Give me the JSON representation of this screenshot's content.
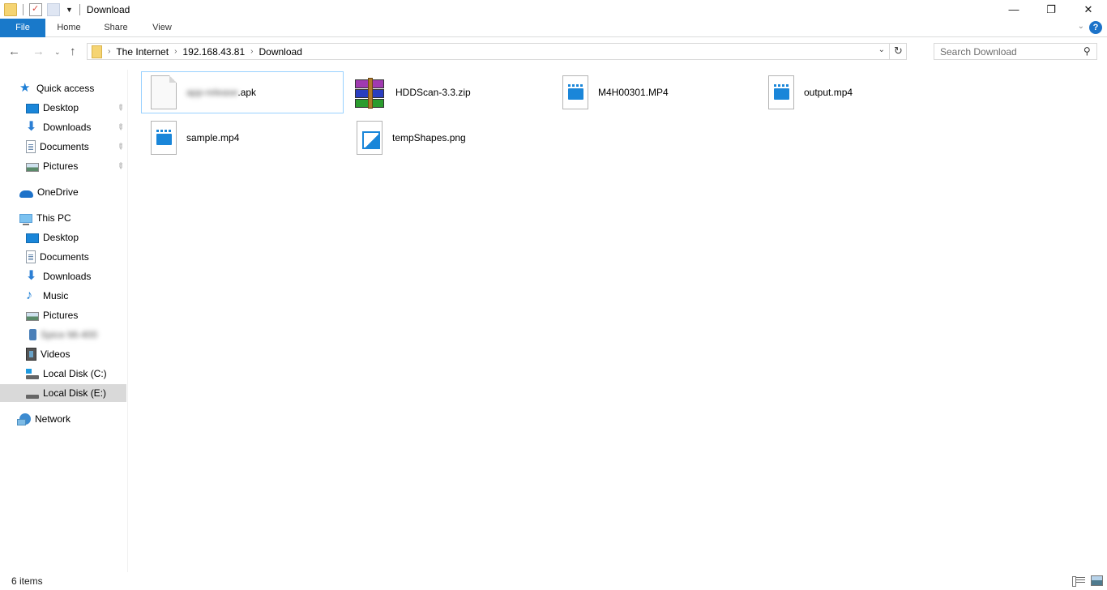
{
  "window": {
    "title": "Download",
    "controls": {
      "minimize": "—",
      "restore": "❐",
      "close": "✕"
    }
  },
  "ribbon": {
    "tabs": [
      {
        "label": "File",
        "active": true
      },
      {
        "label": "Home"
      },
      {
        "label": "Share"
      },
      {
        "label": "View"
      }
    ],
    "expand_glyph": "⌄",
    "help_glyph": "?"
  },
  "nav": {
    "back": "←",
    "forward": "→",
    "recent": "⌄",
    "up": "↑",
    "breadcrumb": [
      "The Internet",
      "192.168.43.81",
      "Download"
    ],
    "crumb_sep": "›",
    "dropdown": "⌄",
    "refresh": "↻"
  },
  "search": {
    "placeholder": "Search Download",
    "value": "",
    "icon": "⚲"
  },
  "sidebar": {
    "quick_access": {
      "label": "Quick access",
      "items": [
        {
          "label": "Desktop",
          "icon": "desktop-icon",
          "pinned": true
        },
        {
          "label": "Downloads",
          "icon": "downloads-icon",
          "pinned": true
        },
        {
          "label": "Documents",
          "icon": "documents-icon",
          "pinned": true
        },
        {
          "label": "Pictures",
          "icon": "pictures-icon",
          "pinned": true
        }
      ]
    },
    "onedrive": {
      "label": "OneDrive"
    },
    "this_pc": {
      "label": "This PC",
      "items": [
        {
          "label": "Desktop",
          "icon": "desktop-icon"
        },
        {
          "label": "Documents",
          "icon": "documents-icon"
        },
        {
          "label": "Downloads",
          "icon": "downloads-icon"
        },
        {
          "label": "Music",
          "icon": "music-icon"
        },
        {
          "label": "Pictures",
          "icon": "pictures-icon"
        },
        {
          "label": "Spice Mi-400",
          "icon": "phone-icon",
          "blurred": true
        },
        {
          "label": "Videos",
          "icon": "videos-icon"
        },
        {
          "label": "Local Disk (C:)",
          "icon": "system-disk-icon"
        },
        {
          "label": "Local Disk (E:)",
          "icon": "disk-icon",
          "selected": true
        }
      ]
    },
    "network": {
      "label": "Network"
    },
    "pin_glyph": "📌"
  },
  "files": [
    {
      "name": "app-release.apk",
      "visible_suffix": ".apk",
      "blurred_prefix": "app-release",
      "type": "apk",
      "selected": true
    },
    {
      "name": "HDDScan-3.3.zip",
      "type": "zip"
    },
    {
      "name": "M4H00301.MP4",
      "type": "video"
    },
    {
      "name": "output.mp4",
      "type": "video"
    },
    {
      "name": "sample.mp4",
      "type": "video"
    },
    {
      "name": "tempShapes.png",
      "type": "image"
    }
  ],
  "status": {
    "item_count": "6 items"
  }
}
